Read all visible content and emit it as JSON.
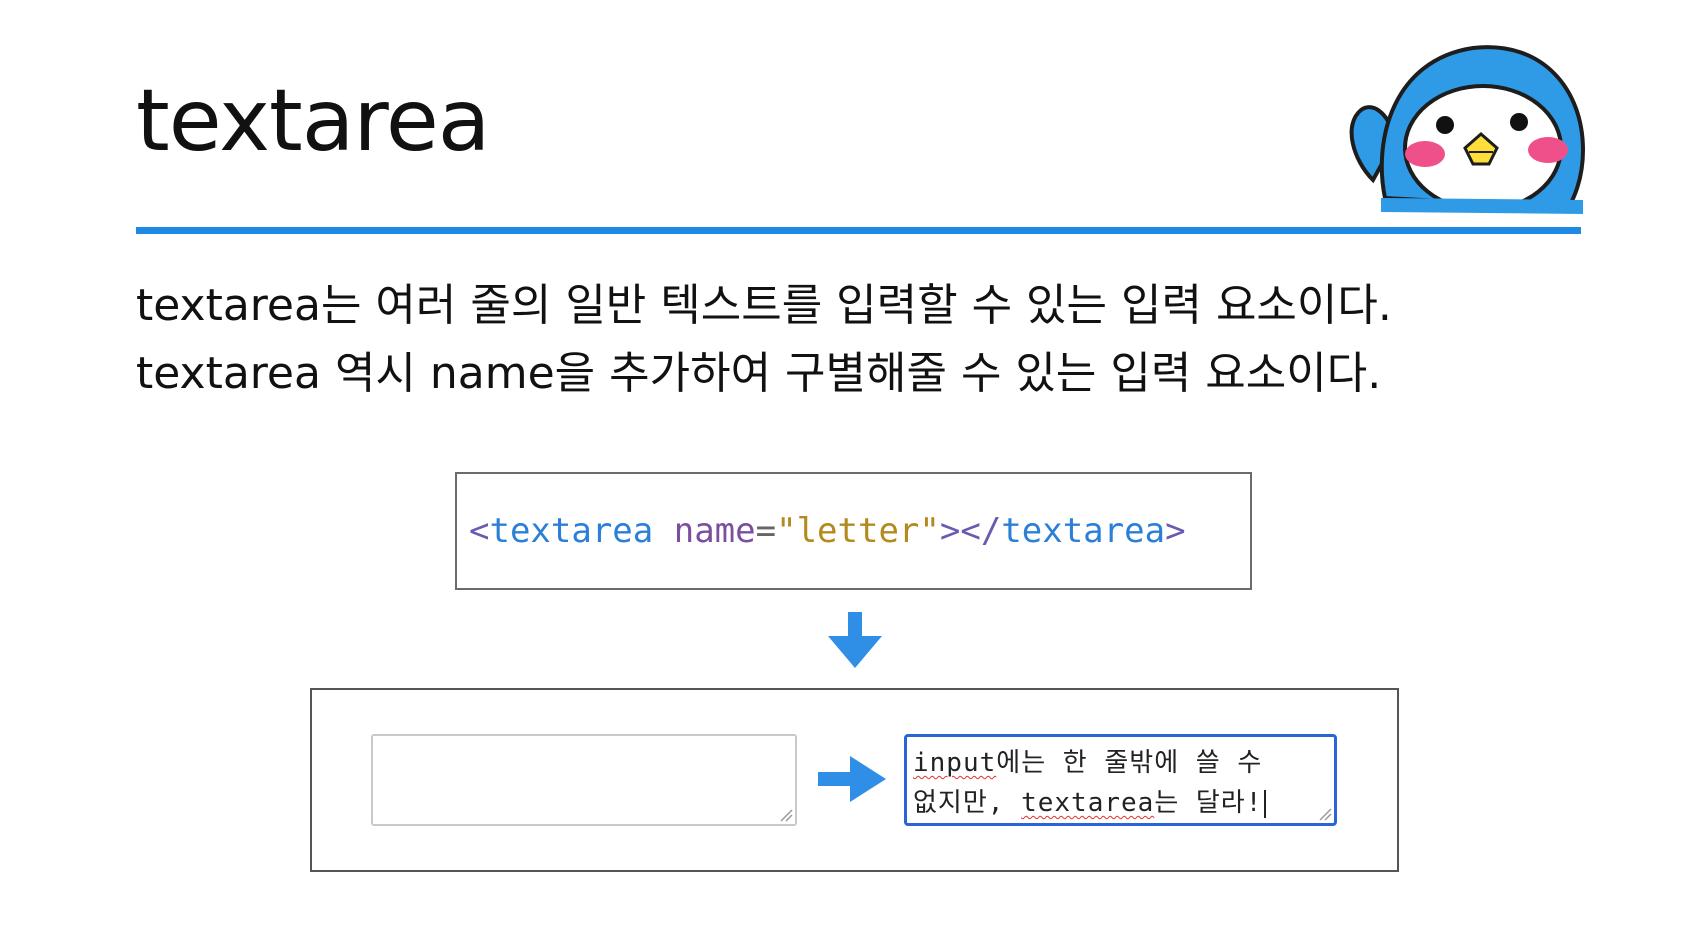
{
  "slide": {
    "title": "textarea",
    "accent_color": "#1f8ae6",
    "description_lines": [
      "textarea는 여러 줄의 일반 텍스트를 입력할 수 있는 입력 요소이다.",
      "textarea 역시 name을 추가하여 구별해줄 수 있는 입력 요소이다."
    ]
  },
  "code_example": {
    "open_bracket": "<",
    "tag": "textarea",
    "attr_name": "name",
    "equals": "=",
    "attr_value": "\"letter\"",
    "close_open": "></",
    "close_tag": "textarea",
    "end_bracket": ">",
    "colors": {
      "bracket": "#6a5bb0",
      "tag": "#2c7fd6",
      "attribute": "#7a4fa0",
      "string": "#b38a1e"
    }
  },
  "demo": {
    "empty_textarea_value": "",
    "filled_textarea": {
      "line1_word": "input",
      "line1_rest": "에는 한 줄밖에 쓸 수",
      "line2_start": "없지만, ",
      "line2_word": "textarea",
      "line2_rest": "는 달라!"
    }
  },
  "icons": {
    "mascot": "penguin-waving-icon",
    "arrow_down": "arrow-down-icon",
    "arrow_right": "arrow-right-icon"
  }
}
